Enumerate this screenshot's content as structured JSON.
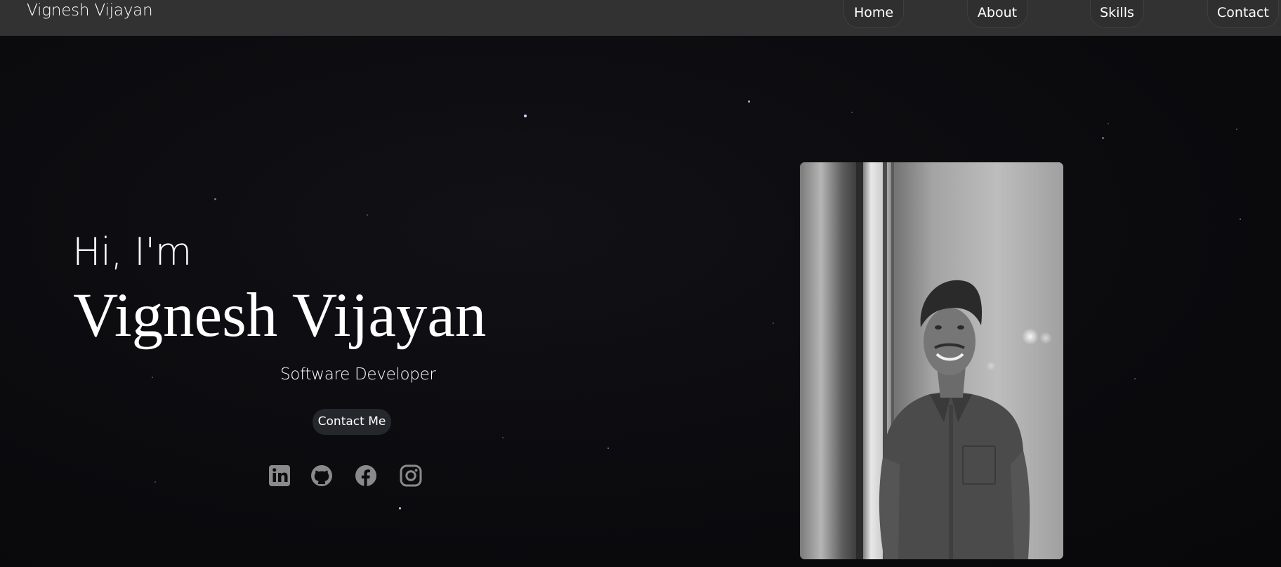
{
  "brand": {
    "name": "Vignesh Vijayan"
  },
  "nav": {
    "items": [
      {
        "label": "Home"
      },
      {
        "label": "About"
      },
      {
        "label": "Skills"
      },
      {
        "label": "Contact"
      }
    ]
  },
  "hero": {
    "greeting": "Hi, I'm",
    "name": "Vignesh Vijayan",
    "role": "Software Developer",
    "cta_label": "Contact Me",
    "socials": [
      {
        "icon": "linkedin-icon"
      },
      {
        "icon": "github-icon"
      },
      {
        "icon": "facebook-icon"
      },
      {
        "icon": "instagram-icon"
      }
    ]
  },
  "colors": {
    "background": "#0c0c0f",
    "navbar": "#323232",
    "button": "#24272c",
    "icon": "#8a8a8a"
  }
}
